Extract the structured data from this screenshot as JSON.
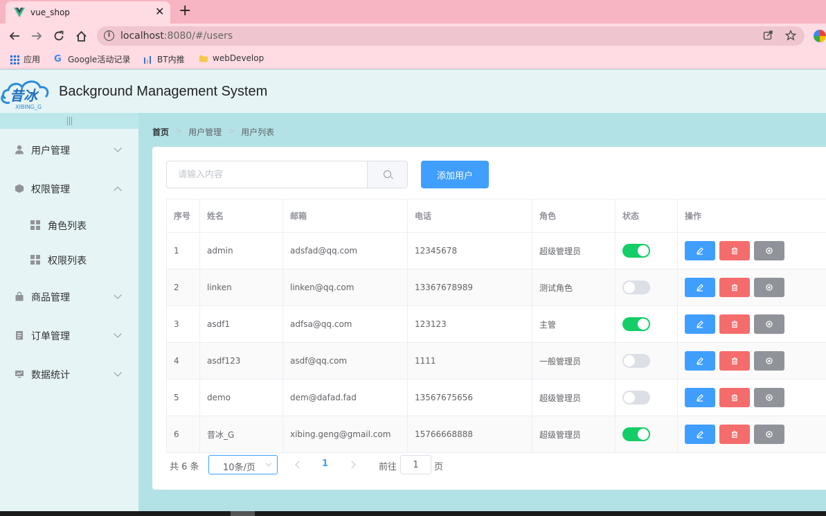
{
  "browser": {
    "tab_title": "vue_shop",
    "close_glyph": "✕",
    "new_tab_glyph": "+",
    "url_host": "localhost",
    "url_path": ":8080/#/users",
    "info_glyph": "i",
    "bookmarks": [
      {
        "label": "应用",
        "icon": "apps-grid-icon"
      },
      {
        "label": "Google活动记录",
        "icon": "google-icon"
      },
      {
        "label": "BT内推",
        "icon": "bar-chart-icon"
      },
      {
        "label": "webDevelop",
        "icon": "folder-icon"
      }
    ]
  },
  "header": {
    "title": "Background Management System",
    "logo_text": "昔冰",
    "logo_subtext": "XIBING_G"
  },
  "sidebar": {
    "collapse_label": "|||",
    "menus": [
      {
        "label": "用户管理",
        "icon": "user-icon",
        "expanded": false
      },
      {
        "label": "权限管理",
        "icon": "cube-icon",
        "expanded": true,
        "children": [
          {
            "label": "角色列表"
          },
          {
            "label": "权限列表"
          }
        ]
      },
      {
        "label": "商品管理",
        "icon": "bag-icon",
        "expanded": false
      },
      {
        "label": "订单管理",
        "icon": "document-icon",
        "expanded": false
      },
      {
        "label": "数据统计",
        "icon": "monitor-icon",
        "expanded": false
      }
    ]
  },
  "breadcrumb": {
    "home": "首页",
    "level1": "用户管理",
    "level2": "用户列表",
    "separator": ">"
  },
  "toolbar": {
    "search_placeholder": "请输入内容",
    "add_label": "添加用户"
  },
  "table": {
    "columns": [
      "序号",
      "姓名",
      "邮箱",
      "电话",
      "角色",
      "状态",
      "操作"
    ],
    "rows": [
      {
        "index": "1",
        "name": "admin",
        "email": "adsfad@qq.com",
        "phone": "12345678",
        "role": "超级管理员",
        "status": true
      },
      {
        "index": "2",
        "name": "linken",
        "email": "linken@qq.com",
        "phone": "13367678989",
        "role": "测试角色",
        "status": false
      },
      {
        "index": "3",
        "name": "asdf1",
        "email": "adfsa@qq.com",
        "phone": "123123",
        "role": "主管",
        "status": true
      },
      {
        "index": "4",
        "name": "asdf123",
        "email": "asdf@qq.com",
        "phone": "1111",
        "role": "一般管理员",
        "status": false
      },
      {
        "index": "5",
        "name": "demo",
        "email": "dem@dafad.fad",
        "phone": "13567675656",
        "role": "超级管理员",
        "status": false
      },
      {
        "index": "6",
        "name": "昔冰_G",
        "email": "xibing.geng@gmail.com",
        "phone": "15766668888",
        "role": "超级管理员",
        "status": true
      }
    ]
  },
  "pagination": {
    "total_text": "共 6 条",
    "page_size": "10条/页",
    "current_page": "1",
    "goto_label": "前往",
    "goto_value": "1",
    "page_unit": "页"
  },
  "colors": {
    "primary": "#409eff",
    "danger": "#f56c6c",
    "info": "#909399",
    "switch_on": "#13ce66",
    "switch_off": "#dcdfe6",
    "main_bg": "#b2e2e6"
  }
}
